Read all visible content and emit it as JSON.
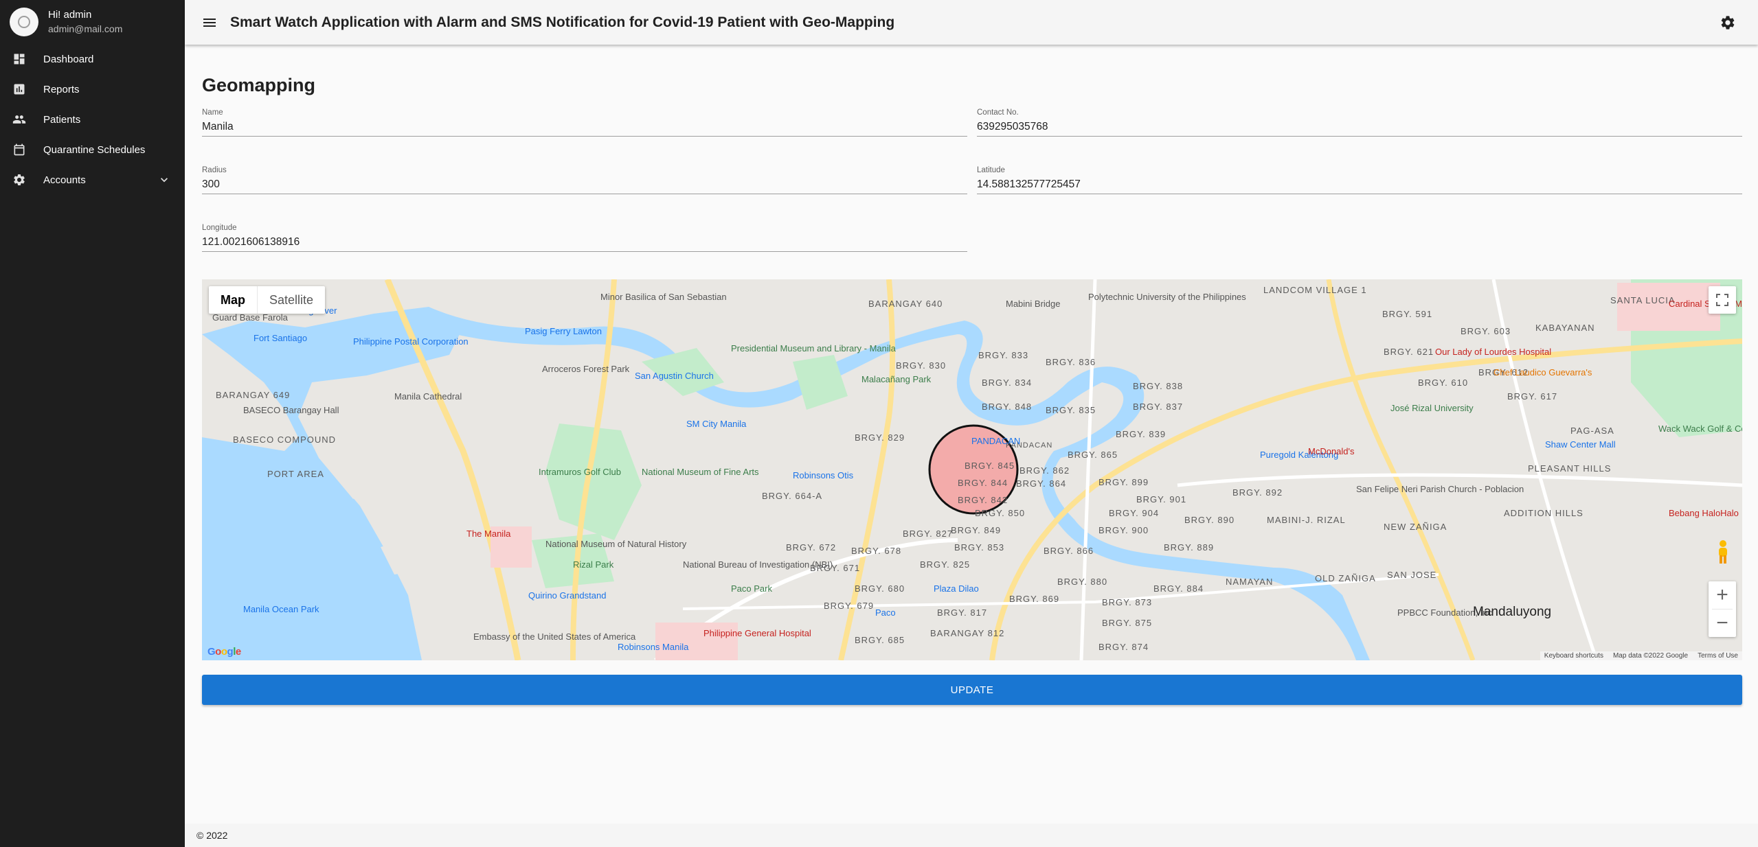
{
  "header": {
    "title": "Smart Watch Application with Alarm and SMS Notification for Covid-19 Patient with Geo-Mapping"
  },
  "user": {
    "greeting": "Hi! admin",
    "email": "admin@mail.com"
  },
  "sidebar": {
    "items": [
      {
        "label": "Dashboard",
        "icon": "dashboard-icon"
      },
      {
        "label": "Reports",
        "icon": "bar-chart-icon"
      },
      {
        "label": "Patients",
        "icon": "people-icon"
      },
      {
        "label": "Quarantine Schedules",
        "icon": "calendar-icon"
      },
      {
        "label": "Accounts",
        "icon": "gear-icon"
      }
    ]
  },
  "page": {
    "title": "Geomapping"
  },
  "form": {
    "name": {
      "label": "Name",
      "value": "Manila"
    },
    "contact": {
      "label": "Contact No.",
      "value": "639295035768"
    },
    "radius": {
      "label": "Radius",
      "value": "300"
    },
    "latitude": {
      "label": "Latitude",
      "value": "14.588132577725457"
    },
    "longitude": {
      "label": "Longitude",
      "value": "121.0021606138916"
    }
  },
  "map": {
    "type_map": "Map",
    "type_satellite": "Satellite",
    "zoom_in": "+",
    "zoom_out": "−",
    "keyboard_shortcuts": "Keyboard shortcuts",
    "map_data": "Map data ©2022 Google",
    "terms": "Terms of Use",
    "logo": "Google",
    "labels": {
      "mandaluyong": "Mandaluyong",
      "pag_asa": "PAG-ASA",
      "kabayanan": "KABAYANAN",
      "santa_lucia": "SANTA LUCIA",
      "baseco": "BASECO COMPOUND",
      "port_area": "PORT AREA",
      "the_manila": "The Manila",
      "paco_park": "Paco Park",
      "rizal_park": "Rizal Park",
      "pasig_river": "Pasig River",
      "san_jose": "SAN JOSE",
      "old_zaniga": "OLD ZAÑIGA",
      "new_zaniga": "NEW ZAÑIGA",
      "addition_hills": "ADDITION HILLS",
      "namayan": "NAMAYAN",
      "robinsons_manila": "Robinsons Manila",
      "philippine_general_hospital": "Philippine General Hospital",
      "national_museum": "National Museum of Fine Arts",
      "intramuros": "Intramuros Golf Club",
      "malacanang": "Malacañang Park",
      "sm_city_manila": "SM City Manila",
      "barangay_649": "BARANGAY 649",
      "barangay_640": "BARANGAY 640",
      "mabini_bridge": "Mabini Bridge",
      "landcom": "LANDCOM VILLAGE 1",
      "fort_santiago": "Fort Santiago",
      "manila_cathedral": "Manila Cathedral",
      "san_agustin": "San Agustin Church",
      "pandacan": "PANDACAN",
      "brgy_845": "BRGY. 845",
      "brgy_844": "BRGY. 844",
      "brgy_842": "BRGY. 842",
      "brgy_830": "BRGY. 830",
      "brgy_836": "BRGY. 836",
      "brgy_848": "BRGY. 848",
      "brgy_835": "BRGY. 835",
      "brgy_865": "BRGY. 865",
      "brgy_899": "BRGY. 899",
      "brgy_866": "BRGY. 866",
      "brgy_849": "BRGY. 849",
      "brgy_853": "BRGY. 853",
      "brgy_827": "BRGY. 827",
      "brgy_825": "BRGY. 825",
      "brgy_817": "BRGY. 817",
      "brgy_880": "BRGY. 880",
      "brgy_869": "BRGY. 869",
      "brgy_873": "BRGY. 873",
      "brgy_874": "BRGY. 874",
      "brgy_890": "BRGY. 890",
      "brgy_892": "BRGY. 892",
      "brgy_617": "BRGY. 617",
      "brgy_610": "BRGY. 610",
      "brgy_612": "BRGY. 612",
      "brgy_603": "BRGY. 603",
      "brgy_621": "BRGY. 621",
      "brgy_591": "BRGY. 591",
      "brgy_664a": "BRGY. 664-A",
      "brgy_672": "BRGY. 672",
      "brgy_678": "BRGY. 678",
      "brgy_671": "BRGY. 671",
      "brgy_680": "BRGY. 680",
      "brgy_679": "BRGY. 679",
      "brgy_685": "BRGY. 685",
      "brgy_829": "BRGY. 829",
      "brgy_833": "BRGY. 833",
      "brgy_834": "BRGY. 834",
      "brgy_838": "BRGY. 838",
      "brgy_837": "BRGY. 837",
      "brgy_839": "BRGY. 839",
      "brgy_862": "BRGY. 862",
      "brgy_864": "BRGY. 864",
      "brgy_901": "BRGY. 901",
      "brgy_904": "BRGY. 904",
      "brgy_900": "BRGY. 900",
      "brgy_889": "BRGY. 889",
      "brgy_884": "BRGY. 884",
      "brgy_875": "BRGY. 875",
      "brgy_812": "BARANGAY 812",
      "brgy_850": "BRGY. 850",
      "mabini_rizal": "MABINI-J. RIZAL",
      "jose_rizal": "José Rizal University",
      "shaw_center": "Shaw Center Mall",
      "mcdonalds": "McDonald's",
      "plaza_dilao": "Plaza Dilao",
      "paco": "Paco",
      "pleasant_hills": "PLEASANT HILLS",
      "cardinal_santos": "Cardinal Santos Medical Center",
      "wack_wack": "Wack Wack Golf & Country Club",
      "pasig_ferry": "Pasig Ferry Lawton",
      "presidential_museum": "Presidential Museum and Library - Manila",
      "manila_ocean_park": "Manila Ocean Park",
      "quirino": "Quirino Grandstand",
      "nbi": "National Bureau of Investigation (NBI)",
      "guard_base": "Guard Base Farola",
      "baseco_hall": "BASECO Barangay Hall",
      "our_lady": "Our Lady of Lourdes Hospital",
      "chef_laudico": "Chef Laudico Guevarra's",
      "robinsons_otis": "Robinsons Otis",
      "puregold": "Puregold Kalentong",
      "san_felipe": "San Felipe Neri Parish Church - Poblacion",
      "pbcc": "PPBCC Foundation, Inc",
      "national_museum_nh": "National Museum of Natural History",
      "philippine_postal": "Philippine Postal Corporation",
      "arroceros": "Arroceros Forest Park",
      "polytechnic": "Polytechnic University of the Philippines",
      "minor_basilica": "Minor Basilica of San Sebastian",
      "embassy": "Embassy of the United States of America",
      "bebang": "Bebang HaloHalo"
    }
  },
  "marker": {
    "fill": "#f4a0a0",
    "stroke": "#111111",
    "radius_m": 300
  },
  "actions": {
    "update_label": "UPDATE"
  },
  "footer": {
    "text": "© 2022"
  },
  "colors": {
    "primary": "#1976d2",
    "sidebar_bg": "#1e1e1e",
    "water": "#aadaff",
    "park": "#c3eccb"
  }
}
